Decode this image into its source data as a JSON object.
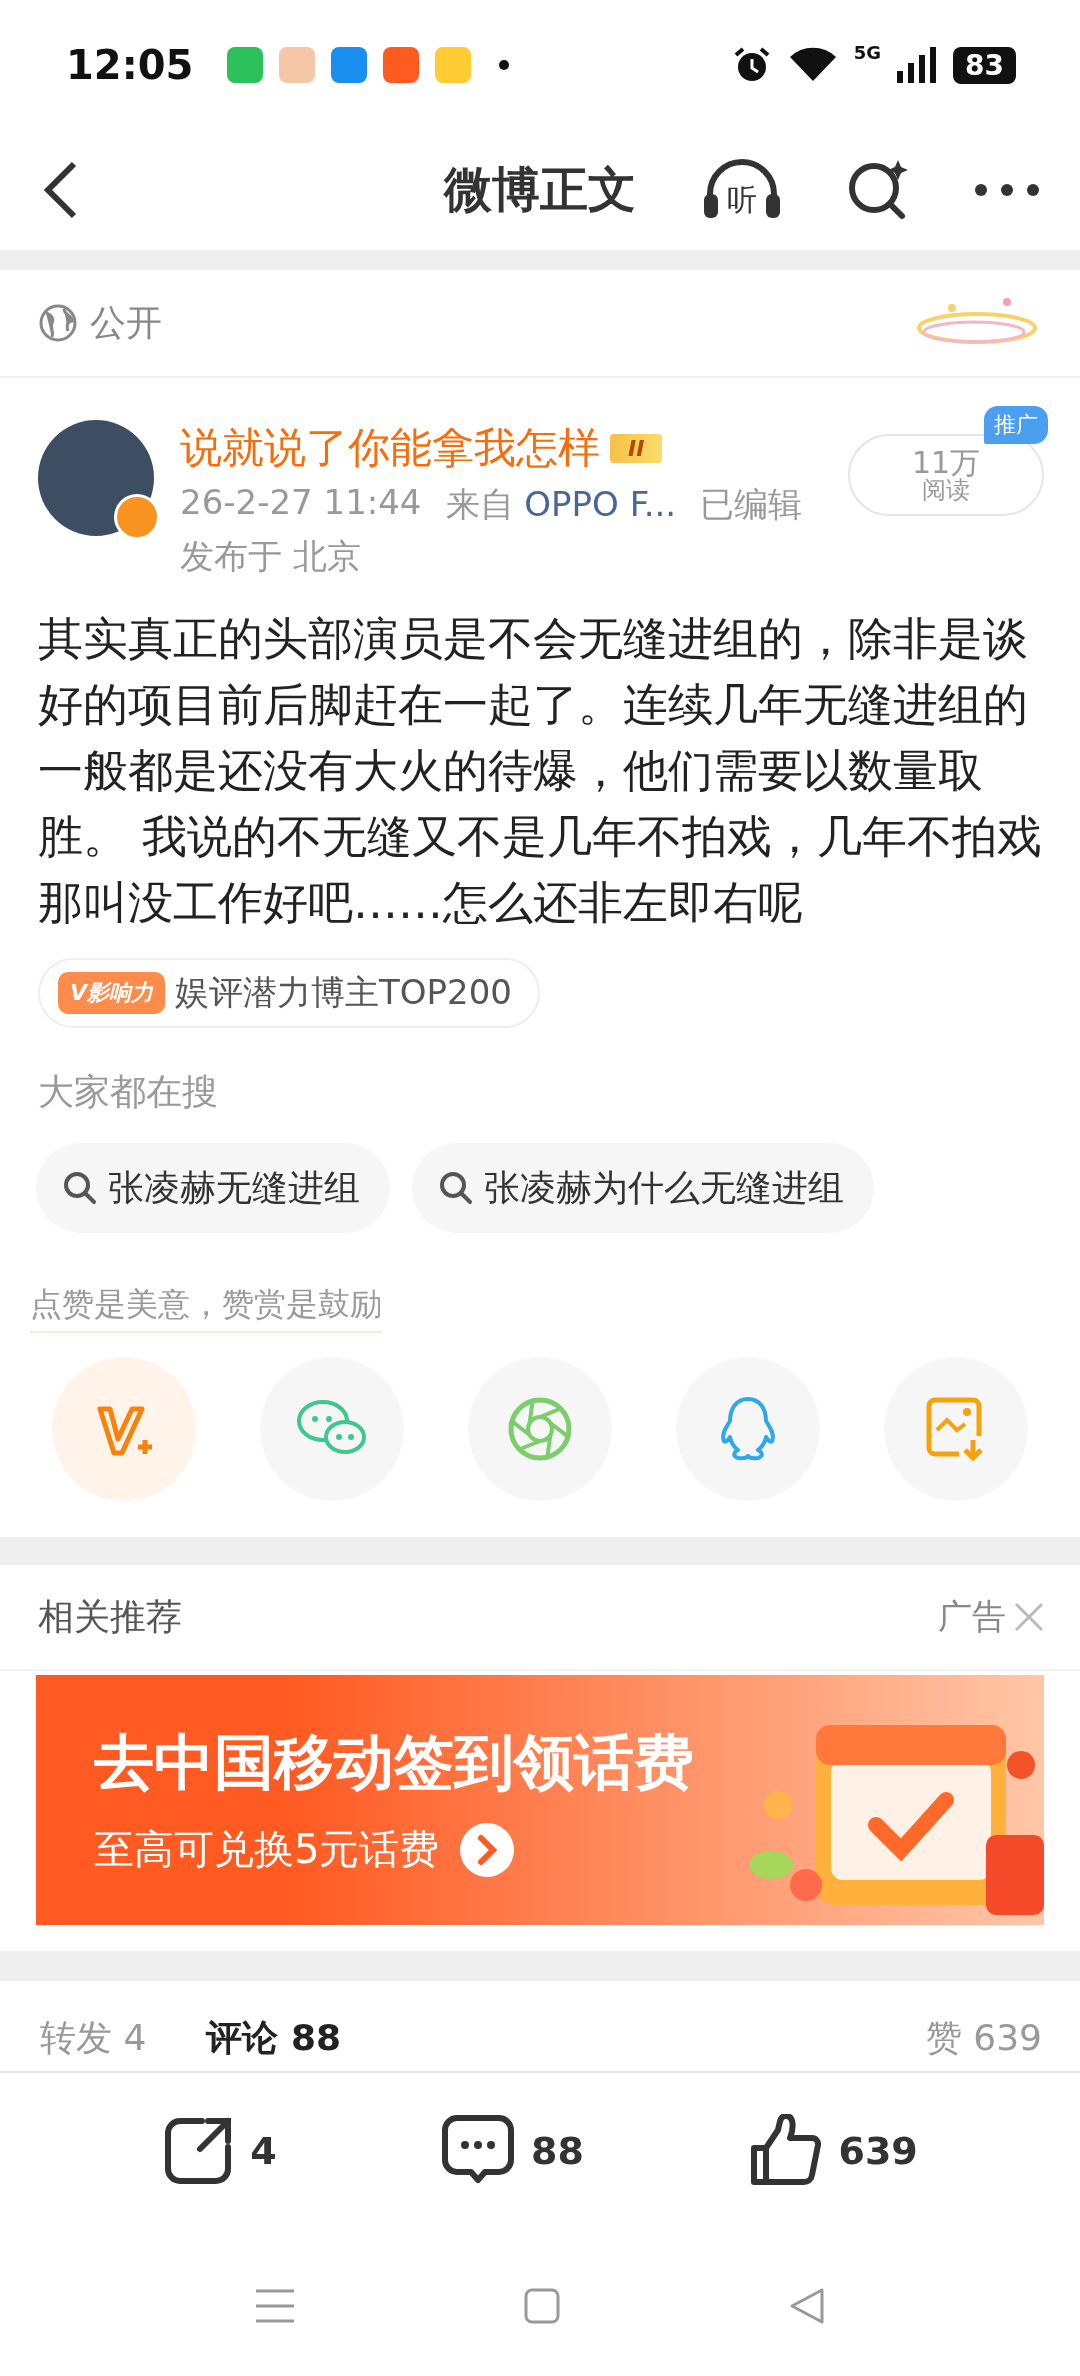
{
  "status_bar": {
    "time": "12:05",
    "network": "5G",
    "battery": "83",
    "apps": [
      {
        "color": "#2dc15b"
      },
      {
        "color": "#f5c6a8"
      },
      {
        "color": "#1a8ef0"
      },
      {
        "color": "#ff5a1f"
      },
      {
        "color": "#ffcc33"
      }
    ]
  },
  "header": {
    "title": "微博正文",
    "listen": "听"
  },
  "visibility": "公开",
  "author": {
    "name": "说就说了你能拿我怎样",
    "level": "II",
    "time": "26-2-27 11:44",
    "source_prefix": "来自",
    "source": "OPPO F...",
    "edited": "已编辑",
    "location": "发布于 北京",
    "reads": "11万",
    "reads_label": "阅读",
    "promo": "推广"
  },
  "body": "其实真正的头部演员是不会无缝进组的，除非是谈好的项目前后脚赶在一起了。连续几年无缝进组的一般都是还没有大火的待爆，他们需要以数量取胜。 我说的不无缝又不是几年不拍戏，几年不拍戏那叫没工作好吧……怎么还非左即右呢",
  "influence": {
    "tag": "V影响力",
    "text": "娱评潜力博主TOP200"
  },
  "hot_search": {
    "title": "大家都在搜",
    "items": [
      "张凌赫无缝进组",
      "张凌赫为什么无缝进组"
    ]
  },
  "share": {
    "hint": "点赞是美意，赞赏是鼓励",
    "items": [
      {
        "kind": "vplus",
        "selected": true
      },
      {
        "kind": "wechat",
        "selected": false
      },
      {
        "kind": "moments",
        "selected": false
      },
      {
        "kind": "qq",
        "selected": false
      },
      {
        "kind": "save",
        "selected": false
      }
    ]
  },
  "related": {
    "title": "相关推荐",
    "ad_label": "广告",
    "headline": "去中国移动签到领话费",
    "subline": "至高可兑换5元话费"
  },
  "tabs": [
    {
      "label": "转发",
      "count": "4",
      "selected": false
    },
    {
      "label": "评论",
      "count": "88",
      "selected": true
    },
    {
      "label": "赞",
      "count": "639",
      "selected": false
    }
  ],
  "actions": [
    {
      "kind": "repost",
      "count": "4"
    },
    {
      "kind": "comment",
      "count": "88"
    },
    {
      "kind": "like",
      "count": "639"
    }
  ]
}
